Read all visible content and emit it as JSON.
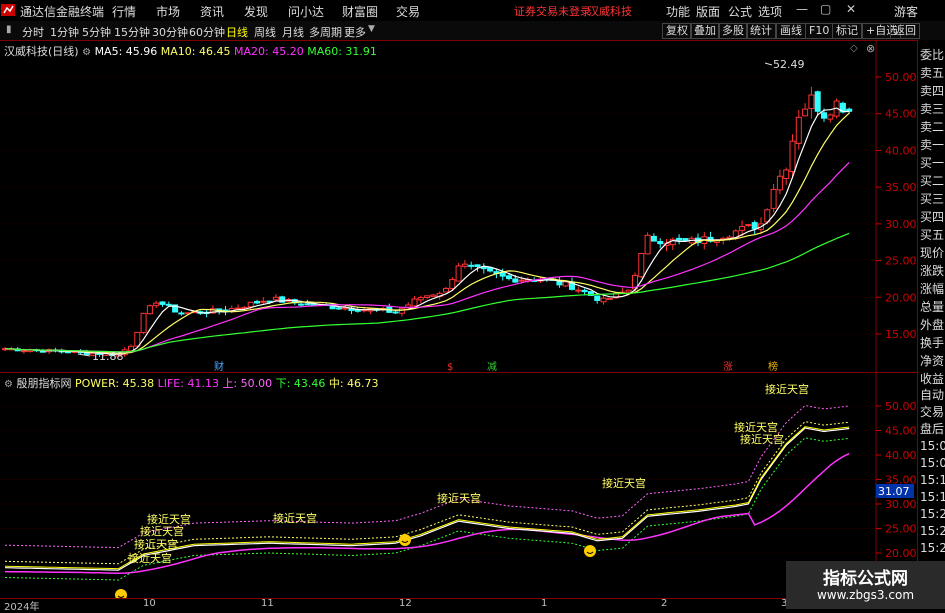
{
  "app": {
    "title": "通达信金融终端"
  },
  "menu": [
    "行情",
    "市场",
    "资讯",
    "发现",
    "问小达",
    "财富圈",
    "交易"
  ],
  "status": {
    "login": "证券交易未登录",
    "stock_name": "汉威科技"
  },
  "menu_right": [
    "功能",
    "版面",
    "公式",
    "选项",
    "游客"
  ],
  "periods": [
    "分时",
    "1分钟",
    "5分钟",
    "15分钟",
    "30分钟",
    "60分钟",
    "日线",
    "周线",
    "月线",
    "多周期",
    "更多"
  ],
  "active_period": "日线",
  "toolbar_right": [
    "复权",
    "叠加",
    "多股",
    "统计",
    "画线",
    "F10",
    "标记",
    "+自选",
    "返回"
  ],
  "main_chart": {
    "title": "汉威科技(日线)",
    "ma5": "MA5: 45.96",
    "ma10": "MA10: 46.45",
    "ma20": "MA20: 45.20",
    "ma60": "MA60: 31.91",
    "high_label": "52.49",
    "low_label": "11.88",
    "price_ticks": [
      "50.00",
      "45.00",
      "40.00",
      "35.00",
      "30.00",
      "25.00",
      "20.00",
      "15.00"
    ],
    "markers": [
      {
        "text": "财",
        "color": "#4aa8ff"
      },
      {
        "text": "$",
        "color": "#e33"
      },
      {
        "text": "减",
        "color": "#3c3"
      },
      {
        "text": "涨",
        "color": "#e33"
      },
      {
        "text": "榜",
        "color": "#e8b000"
      }
    ],
    "colors": {
      "up": "#ff3333",
      "down": "#33ffff",
      "ma5": "#ffffff",
      "ma10": "#ffff66",
      "ma20": "#ff33ff",
      "ma60": "#33ff33"
    }
  },
  "indicator": {
    "name": "殷朋指标网",
    "power": "POWER: 45.38",
    "life": "LIFE: 41.13",
    "up": "上: 50.00",
    "down": "下: 43.46",
    "mid": "中: 46.73",
    "ticks": [
      "50.00",
      "45.00",
      "40.00",
      "35.00",
      "30.00",
      "25.00",
      "20.00"
    ],
    "current_value": "31.07",
    "signal_label": "接近天宫",
    "clipped_label": "接近天宫"
  },
  "x_axis": [
    "2024年",
    "10",
    "11",
    "12",
    "1",
    "2",
    "3"
  ],
  "right_panel": [
    "委比",
    "卖五",
    "卖四",
    "卖三",
    "卖二",
    "卖一",
    "买一",
    "买二",
    "买三",
    "买四",
    "买五",
    "现价",
    "涨跌",
    "涨幅",
    "总量",
    "外盘",
    "换手",
    "净资",
    "收益",
    "自动",
    "交易",
    "盘后",
    "15:00",
    "15:0",
    "15:1",
    "15:1",
    "15:2",
    "15:2",
    "15:2"
  ],
  "watermark": {
    "line1": "指标公式网",
    "line2": "www.zbgs3.com"
  }
}
